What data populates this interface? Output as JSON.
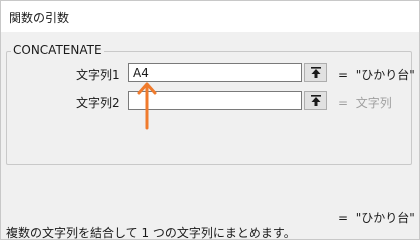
{
  "window": {
    "title": "関数の引数"
  },
  "function": {
    "name": "CONCATENATE",
    "args": [
      {
        "label": "文字列1",
        "value": "A4",
        "eq": "=",
        "result": "\"ひかり台\""
      },
      {
        "label": "文字列2",
        "value": "",
        "eq": "=",
        "result": "文字列"
      }
    ]
  },
  "formula_result": {
    "eq": "=",
    "value": "\"ひかり台\""
  },
  "description": "複数の文字列を結合して 1 つの文字列にまとめます。",
  "annotation": {
    "arrow_color": "#f07b2d"
  }
}
